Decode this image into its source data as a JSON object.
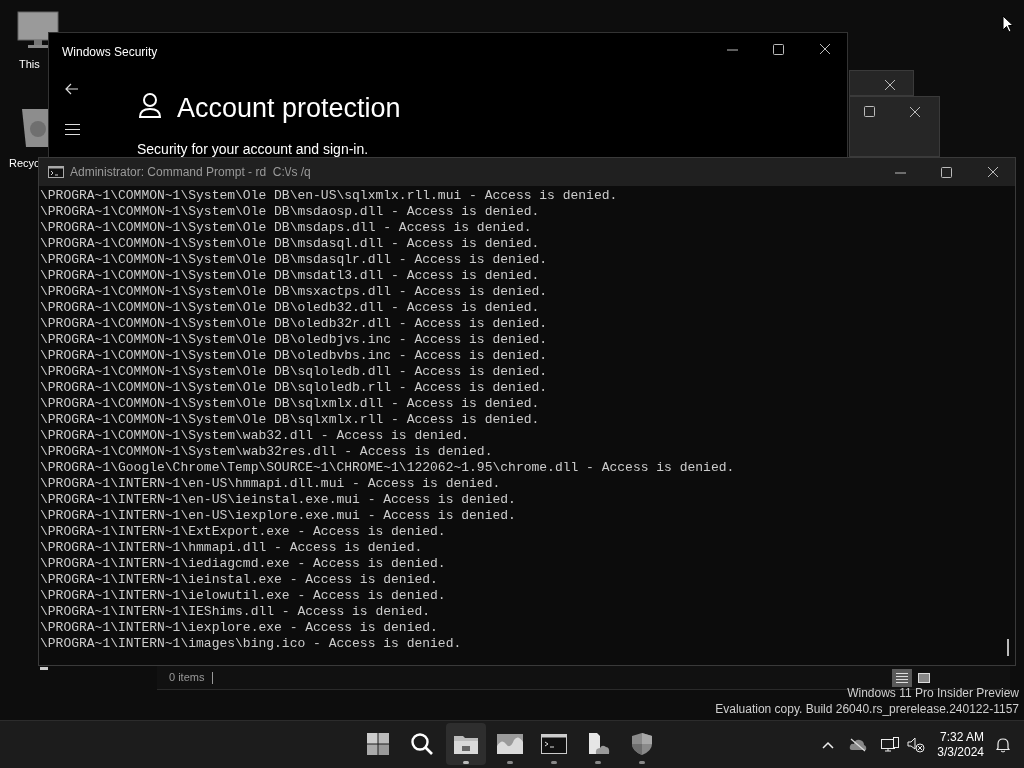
{
  "desktop_icons": [
    {
      "kind": "monitor",
      "label": "This"
    },
    {
      "kind": "bin",
      "label": "Recyc"
    }
  ],
  "security_window": {
    "title": "Windows Security",
    "heading": "Account protection",
    "subtitle": "Security for your account and sign-in."
  },
  "command_prompt": {
    "title": "Administrator: Command Prompt - rd  C:\\/s /q",
    "lines": [
      "\\PROGRA~1\\COMMON~1\\System\\Ole DB\\en-US\\sqlxmlx.rll.mui - Access is denied.",
      "\\PROGRA~1\\COMMON~1\\System\\Ole DB\\msdaosp.dll - Access is denied.",
      "\\PROGRA~1\\COMMON~1\\System\\Ole DB\\msdaps.dll - Access is denied.",
      "\\PROGRA~1\\COMMON~1\\System\\Ole DB\\msdasql.dll - Access is denied.",
      "\\PROGRA~1\\COMMON~1\\System\\Ole DB\\msdasqlr.dll - Access is denied.",
      "\\PROGRA~1\\COMMON~1\\System\\Ole DB\\msdatl3.dll - Access is denied.",
      "\\PROGRA~1\\COMMON~1\\System\\Ole DB\\msxactps.dll - Access is denied.",
      "\\PROGRA~1\\COMMON~1\\System\\Ole DB\\oledb32.dll - Access is denied.",
      "\\PROGRA~1\\COMMON~1\\System\\Ole DB\\oledb32r.dll - Access is denied.",
      "\\PROGRA~1\\COMMON~1\\System\\Ole DB\\oledbjvs.inc - Access is denied.",
      "\\PROGRA~1\\COMMON~1\\System\\Ole DB\\oledbvbs.inc - Access is denied.",
      "\\PROGRA~1\\COMMON~1\\System\\Ole DB\\sqloledb.dll - Access is denied.",
      "\\PROGRA~1\\COMMON~1\\System\\Ole DB\\sqloledb.rll - Access is denied.",
      "\\PROGRA~1\\COMMON~1\\System\\Ole DB\\sqlxmlx.dll - Access is denied.",
      "\\PROGRA~1\\COMMON~1\\System\\Ole DB\\sqlxmlx.rll - Access is denied.",
      "\\PROGRA~1\\COMMON~1\\System\\wab32.dll - Access is denied.",
      "\\PROGRA~1\\COMMON~1\\System\\wab32res.dll - Access is denied.",
      "\\PROGRA~1\\Google\\Chrome\\Temp\\SOURCE~1\\CHROME~1\\122062~1.95\\chrome.dll - Access is denied.",
      "\\PROGRA~1\\INTERN~1\\en-US\\hmmapi.dll.mui - Access is denied.",
      "\\PROGRA~1\\INTERN~1\\en-US\\ieinstal.exe.mui - Access is denied.",
      "\\PROGRA~1\\INTERN~1\\en-US\\iexplore.exe.mui - Access is denied.",
      "\\PROGRA~1\\INTERN~1\\ExtExport.exe - Access is denied.",
      "\\PROGRA~1\\INTERN~1\\hmmapi.dll - Access is denied.",
      "\\PROGRA~1\\INTERN~1\\iediagcmd.exe - Access is denied.",
      "\\PROGRA~1\\INTERN~1\\ieinstal.exe - Access is denied.",
      "\\PROGRA~1\\INTERN~1\\ielowutil.exe - Access is denied.",
      "\\PROGRA~1\\INTERN~1\\IEShims.dll - Access is denied.",
      "\\PROGRA~1\\INTERN~1\\iexplore.exe - Access is denied.",
      "\\PROGRA~1\\INTERN~1\\images\\bing.ico - Access is denied."
    ]
  },
  "explorer_status": {
    "item_count": "0 items",
    "view_buttons": [
      {
        "kind": "details",
        "selected": true
      },
      {
        "kind": "tiles",
        "selected": false
      }
    ]
  },
  "os_notice": [
    "Windows 11 Pro Insider Preview",
    "Evaluation copy. Build 26040.rs_prerelease.240122-1157"
  ],
  "taskbar": {
    "apps": [
      {
        "kind": "start",
        "running": false,
        "selected": false
      },
      {
        "kind": "search",
        "running": false,
        "selected": false
      },
      {
        "kind": "folder",
        "running": true,
        "selected": true
      },
      {
        "kind": "photos",
        "running": true,
        "selected": false
      },
      {
        "kind": "terminal",
        "running": true,
        "selected": false
      },
      {
        "kind": "files-cloud",
        "running": true,
        "selected": false
      },
      {
        "kind": "shield",
        "running": true,
        "selected": false
      }
    ],
    "time": "7:32 AM",
    "date": "3/3/2024"
  }
}
